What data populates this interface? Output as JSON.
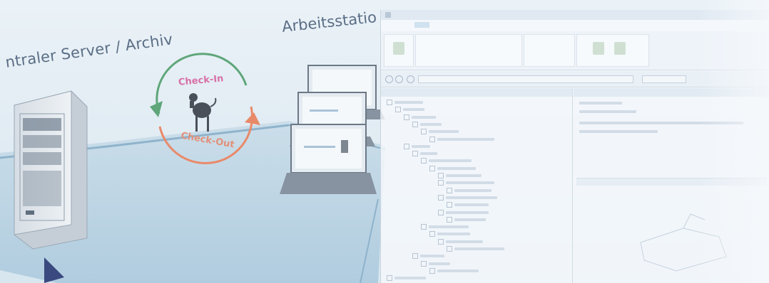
{
  "labels": {
    "server": "ntraler Server / Archiv",
    "workstations": "Arbeitsstatio",
    "check_in": "Check-In",
    "check_out": "Check-Out"
  },
  "colors": {
    "check_in": "#d870a7",
    "check_out": "#e2917a",
    "arrow_green": "#5fa67a",
    "arrow_orange": "#e88a6a",
    "label": "#5b6e86",
    "floor": "#a9c8dc"
  },
  "app": {
    "tab_count": 5,
    "tree_rows": 25,
    "icons": [
      "back-icon",
      "forward-icon",
      "refresh-icon",
      "tree-expand-icon",
      "folder-icon"
    ]
  }
}
